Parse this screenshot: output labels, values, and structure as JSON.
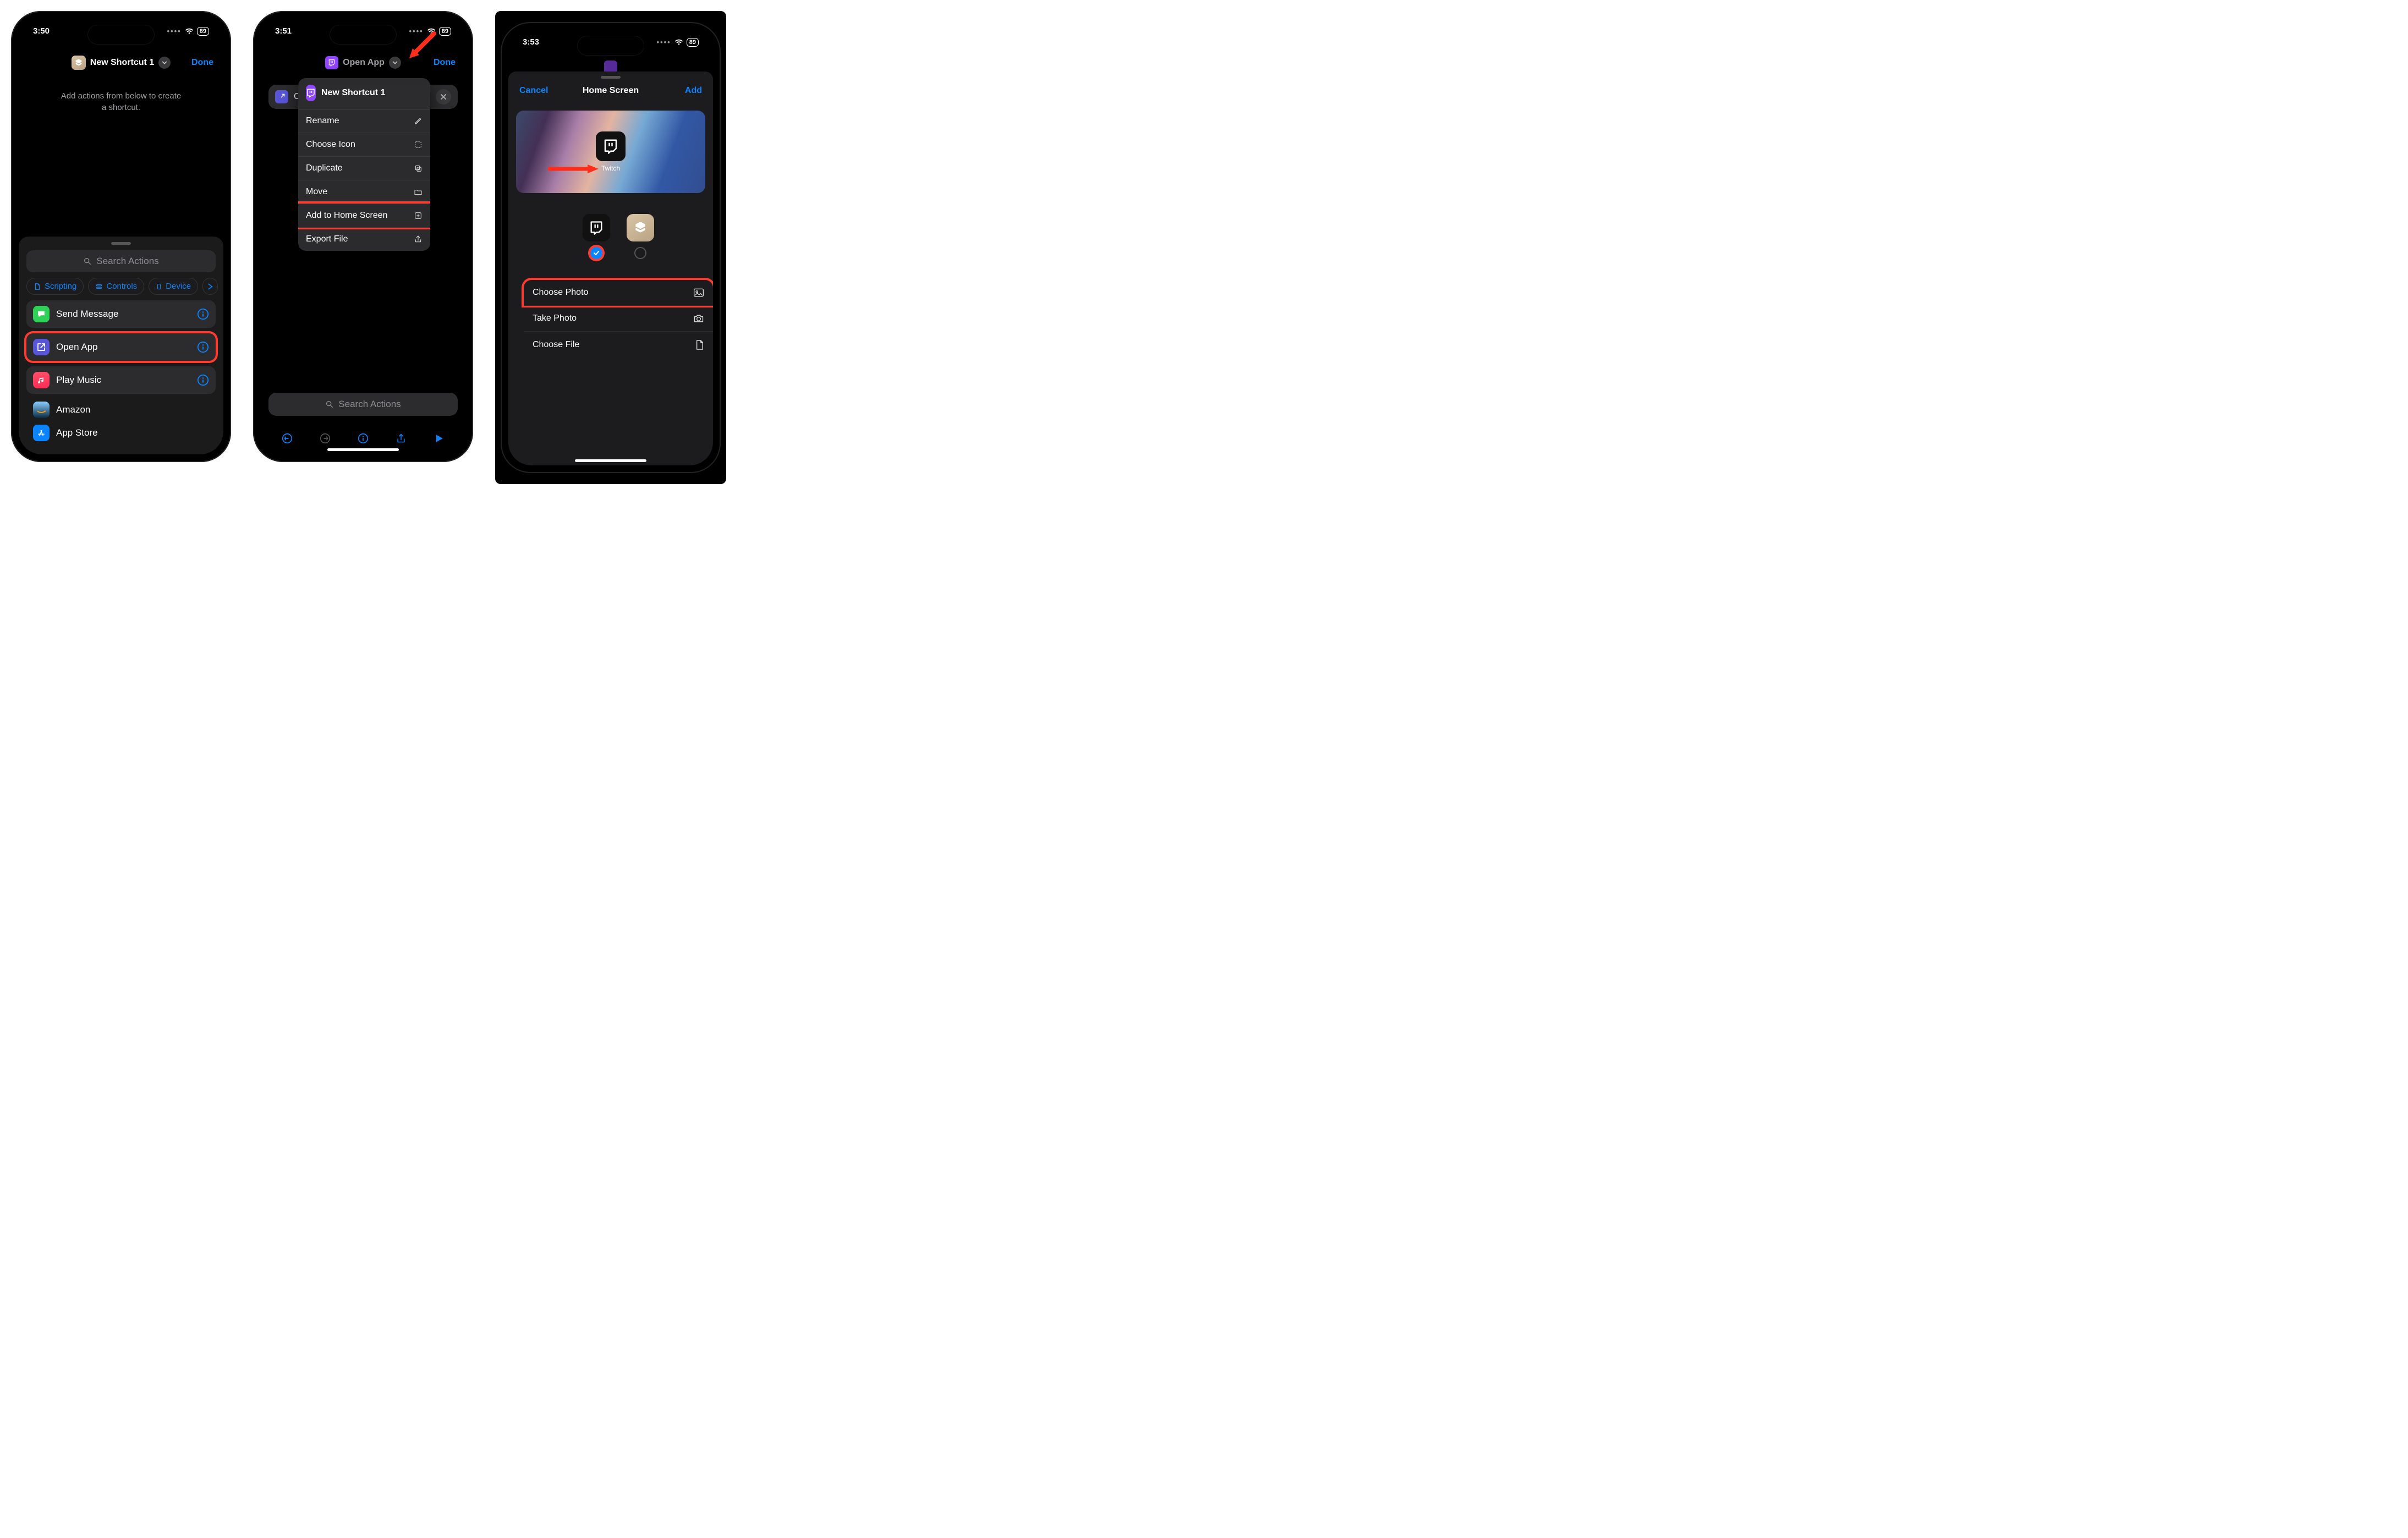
{
  "phone1": {
    "time": "3:50",
    "battery": "89",
    "title": "New Shortcut 1",
    "done": "Done",
    "hint_line1": "Add actions from below to create",
    "hint_line2": "a shortcut.",
    "search_placeholder": "Search Actions",
    "categories": [
      "Scripting",
      "Controls",
      "Device"
    ],
    "actions": [
      {
        "label": "Send Message"
      },
      {
        "label": "Open App"
      },
      {
        "label": "Play Music"
      },
      {
        "label": "Amazon"
      },
      {
        "label": "App Store"
      }
    ]
  },
  "phone2": {
    "time": "3:51",
    "battery": "89",
    "nav_title": "Open App",
    "done": "Done",
    "shortcut_name": "New Shortcut 1",
    "menu": [
      "Rename",
      "Choose Icon",
      "Duplicate",
      "Move",
      "Add to Home Screen",
      "Export File"
    ],
    "search_placeholder": "Search Actions"
  },
  "phone3": {
    "time": "3:53",
    "battery": "89",
    "cancel": "Cancel",
    "nav_title": "Home Screen",
    "add": "Add",
    "app_label": "Twitch",
    "rows": [
      "Choose Photo",
      "Take Photo",
      "Choose File"
    ]
  }
}
